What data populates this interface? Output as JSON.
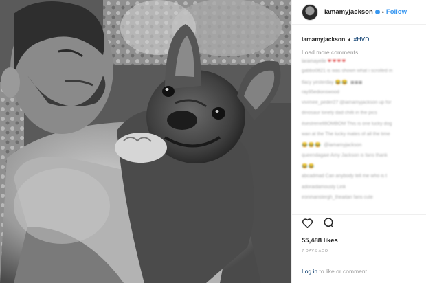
{
  "post": {
    "username": "iamamyjackson",
    "follow_label": "Follow",
    "dot": "•",
    "caption": {
      "username": "iamamyjackson",
      "symbol": "♦",
      "hashtag": "#HVD"
    },
    "load_more": "Load more comments",
    "comments": [
      {
        "text": "laramayelle ",
        "emoji": "❤❤❤❤",
        "emoji_color": "red"
      },
      {
        "text": "gabbo0821 is was shown what i scrolled in",
        "emoji": "",
        "emoji_color": ""
      },
      {
        "text": "tlacy yesterday ",
        "emoji": "😂😂 ",
        "emoji_color": "yellow",
        "tail": "◼◼◼"
      },
      {
        "text": "ray95edionswood",
        "emoji": "",
        "emoji_color": ""
      },
      {
        "text": "vivimee_peder27 @iamamyjackson up for",
        "emoji": "",
        "emoji_color": ""
      },
      {
        "text": "dinosaur lonely dad chilli in the pics",
        "emoji": "",
        "emoji_color": ""
      },
      {
        "text": "ilsestrenell8OMBOM This is one lucky dog",
        "emoji": "",
        "emoji_color": ""
      },
      {
        "text": "wan at the The lucky mates of all the time",
        "emoji": "",
        "emoji_color": ""
      },
      {
        "text": "",
        "emoji": "😂😂😂 ",
        "emoji_color": "yellow",
        "tail": "@iamamyjackson"
      },
      {
        "text": "queendagaie Amy Jackson is fans thank",
        "emoji": "",
        "emoji_color": ""
      },
      {
        "text": "",
        "emoji": "😂😂",
        "emoji_color": "yellow"
      },
      {
        "text": "abcadmad Can anybody tell me who is t",
        "emoji": "",
        "emoji_color": ""
      },
      {
        "text": "adoraidamously Link",
        "emoji": "",
        "emoji_color": ""
      },
      {
        "text": "ironmanstergh_theaitan fans cute",
        "emoji": "",
        "emoji_color": ""
      }
    ],
    "likes": "55,488 likes",
    "timestamp": "7 DAYS AGO",
    "login": {
      "link": "Log in",
      "rest": " to like or comment."
    },
    "icons": {
      "like": "heart-icon",
      "comment": "comment-icon",
      "avatar": "profile-avatar",
      "verified": "verified-badge-icon"
    },
    "colors": {
      "link_blue": "#3897f0",
      "hashtag_blue": "#003569",
      "muted": "#999999",
      "divider": "#efefef"
    }
  }
}
